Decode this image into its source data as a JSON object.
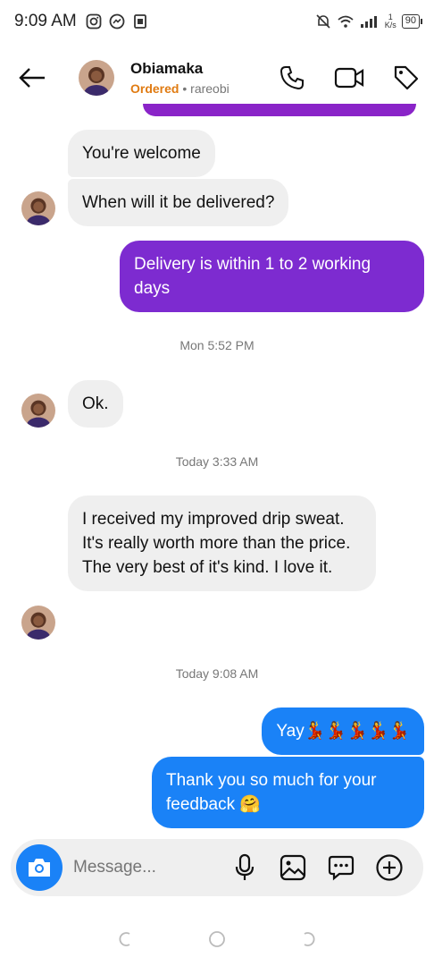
{
  "status_bar": {
    "time": "9:09 AM",
    "net_speed_top": "1",
    "net_speed_unit": "K/s",
    "battery": "90"
  },
  "header": {
    "back_icon": "arrow-left-icon",
    "name": "Obiamaka",
    "status": "Ordered",
    "separator": " • ",
    "username": "rareobi",
    "actions": [
      "phone-icon",
      "video-icon",
      "tag-icon"
    ]
  },
  "messages": [
    {
      "direction": "in",
      "text": "You're welcome"
    },
    {
      "direction": "in",
      "text": "When will it be delivered?"
    },
    {
      "direction": "out",
      "color": "#7d2bd0",
      "text": "Delivery is within 1 to 2 working days"
    },
    {
      "direction": "in",
      "text": "Ok."
    },
    {
      "direction": "in",
      "text": "I received my improved drip sweat.\nIt's really worth more than the price. The very best of it's kind. I love it."
    },
    {
      "direction": "out",
      "color": "#1a82f7",
      "text": "Yay💃💃💃💃💃"
    },
    {
      "direction": "out",
      "color": "#1a82f7",
      "text": "Thank you so much for your feedback 🤗"
    }
  ],
  "timestamps": [
    "Mon 5:52 PM",
    "Today 3:33 AM",
    "Today 9:08 AM"
  ],
  "composer": {
    "placeholder": "Message...",
    "icons": [
      "camera-icon",
      "microphone-icon",
      "gallery-icon",
      "sticker-icon",
      "add-icon"
    ]
  },
  "colors": {
    "purple_bubble": "#7d2bd0",
    "blue_bubble": "#1a82f7",
    "incoming_bubble": "#efefef",
    "ordered_status": "#e07b12"
  }
}
